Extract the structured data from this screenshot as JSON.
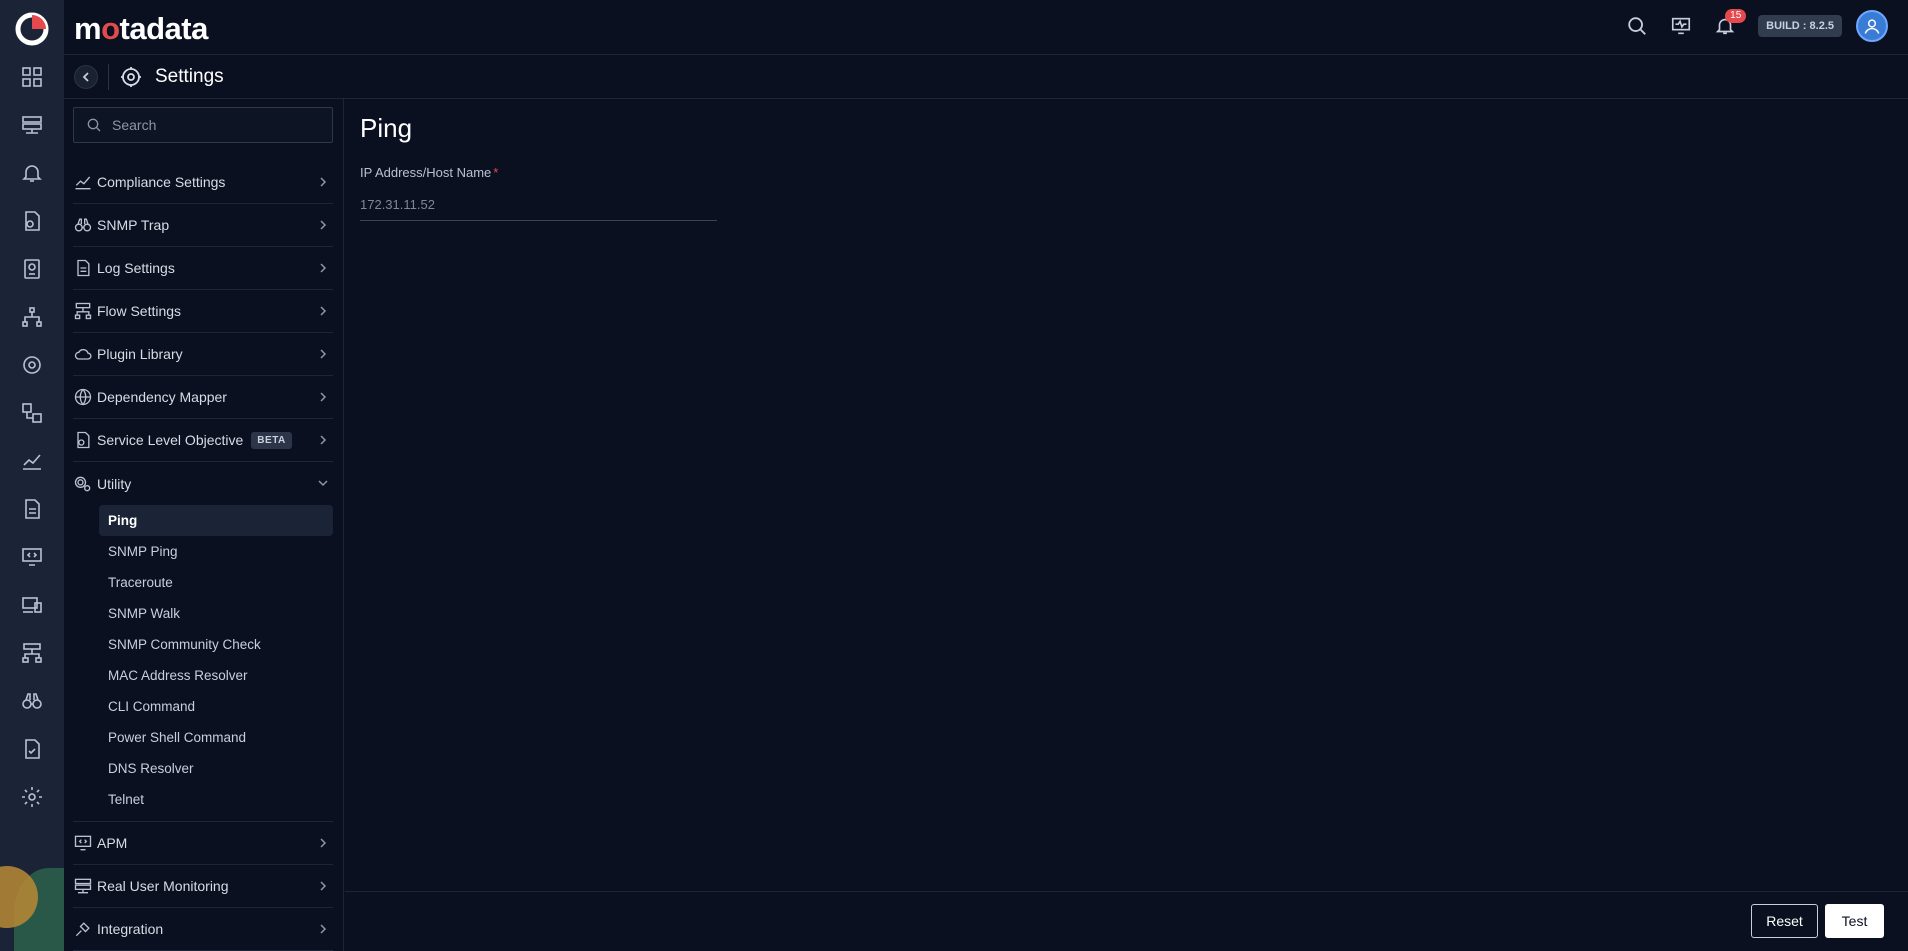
{
  "app": {
    "brand_prefix": "m",
    "brand_dot": "o",
    "brand_suffix": "tadata",
    "build": "BUILD : 8.2.5"
  },
  "notifications": {
    "count": "15"
  },
  "breadcrumb": {
    "title": "Settings"
  },
  "search": {
    "placeholder": "Search"
  },
  "menu": {
    "items": [
      {
        "label": "Compliance Settings",
        "icon": "compliance-icon"
      },
      {
        "label": "SNMP Trap",
        "icon": "binoculars-icon"
      },
      {
        "label": "Log Settings",
        "icon": "log-file-icon"
      },
      {
        "label": "Flow Settings",
        "icon": "flow-icon"
      },
      {
        "label": "Plugin Library",
        "icon": "cloud-plugin-icon"
      },
      {
        "label": "Dependency Mapper",
        "icon": "globe-icon"
      },
      {
        "label": "Service Level Objective",
        "icon": "slo-icon",
        "badge": "BETA"
      },
      {
        "label": "Utility",
        "icon": "gears-icon"
      }
    ],
    "utility_sub": [
      "Ping",
      "SNMP Ping",
      "Traceroute",
      "SNMP Walk",
      "SNMP Community Check",
      "MAC Address Resolver",
      "CLI Command",
      "Power Shell Command",
      "DNS Resolver",
      "Telnet"
    ],
    "after_items": [
      {
        "label": "APM",
        "icon": "apm-monitor-icon"
      },
      {
        "label": "Real User Monitoring",
        "icon": "rum-icon"
      },
      {
        "label": "Integration",
        "icon": "integration-icon"
      }
    ]
  },
  "main": {
    "title": "Ping",
    "field_label": "IP Address/Host Name",
    "required_mark": "*",
    "field_value": "172.31.11.52",
    "reset_label": "Reset",
    "test_label": "Test"
  },
  "colors": {
    "background": "#0a1020",
    "rail": "#1b2436",
    "accent_red": "#e5484d",
    "active_item": "#1b2436"
  }
}
